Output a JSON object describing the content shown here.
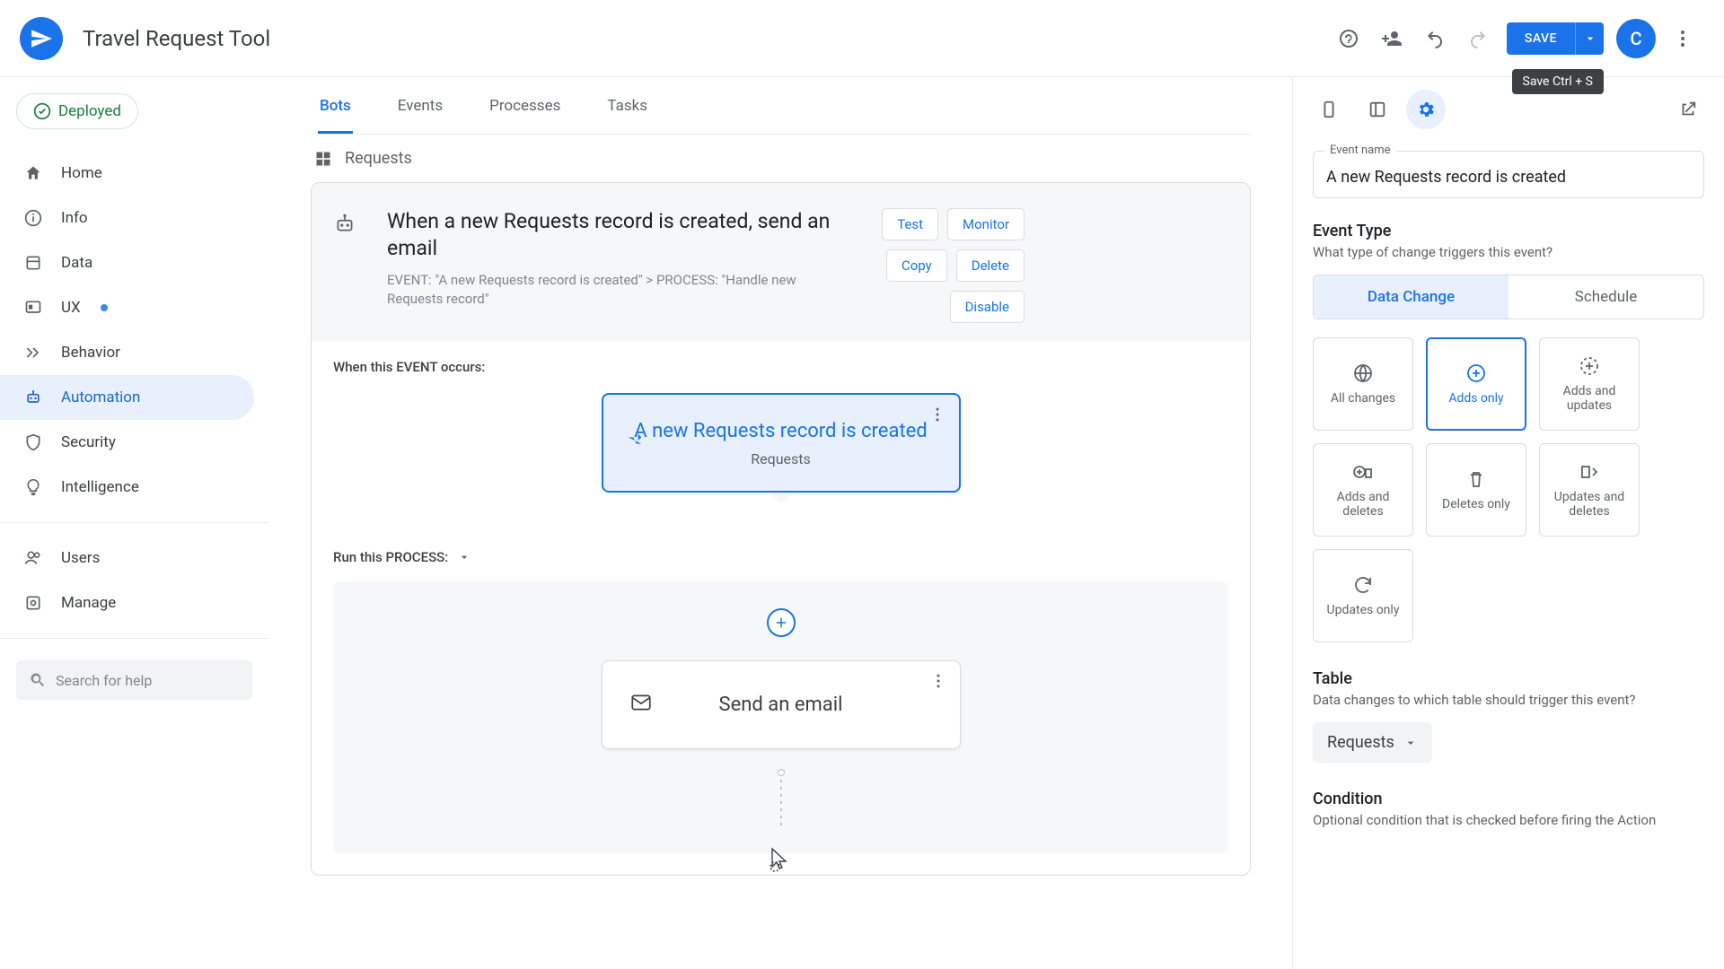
{
  "app": {
    "title": "Travel Request Tool"
  },
  "topbar": {
    "save_label": "SAVE",
    "save_tooltip": "Save Ctrl + S",
    "avatar_letter": "C"
  },
  "sidebar": {
    "deployed_label": "Deployed",
    "items": [
      {
        "label": "Home"
      },
      {
        "label": "Info"
      },
      {
        "label": "Data"
      },
      {
        "label": "UX",
        "dot": true
      },
      {
        "label": "Behavior"
      },
      {
        "label": "Automation",
        "active": true
      },
      {
        "label": "Security"
      },
      {
        "label": "Intelligence"
      }
    ],
    "lower_items": [
      {
        "label": "Users"
      },
      {
        "label": "Manage"
      }
    ],
    "search_placeholder": "Search for help"
  },
  "center": {
    "tabs": [
      {
        "label": "Bots",
        "active": true
      },
      {
        "label": "Events"
      },
      {
        "label": "Processes"
      },
      {
        "label": "Tasks"
      }
    ],
    "breadcrumb": "Requests",
    "bot": {
      "title": "When a new Requests record is created, send an email",
      "subtitle": "EVENT: \"A new Requests record is created\" > PROCESS: \"Handle new Requests record\"",
      "actions": [
        "Test",
        "Monitor",
        "Copy",
        "Delete",
        "Disable"
      ],
      "event_section_label": "When this EVENT occurs:",
      "event_node": {
        "title": "A new Requests record is created",
        "subtitle": "Requests"
      },
      "process_section_label": "Run this PROCESS:",
      "step_node": {
        "title": "Send an email"
      }
    }
  },
  "rpanel": {
    "event_name_label": "Event name",
    "event_name_value": "A new Requests record is created",
    "event_type_title": "Event Type",
    "event_type_desc": "What type of change triggers this event?",
    "segmented": [
      {
        "label": "Data Change",
        "active": true
      },
      {
        "label": "Schedule"
      }
    ],
    "change_options": [
      {
        "label": "All changes"
      },
      {
        "label": "Adds only",
        "active": true
      },
      {
        "label": "Adds and updates"
      },
      {
        "label": "Adds and deletes"
      },
      {
        "label": "Deletes only"
      },
      {
        "label": "Updates and deletes"
      },
      {
        "label": "Updates only"
      }
    ],
    "table_title": "Table",
    "table_desc": "Data changes to which table should trigger this event?",
    "table_value": "Requests",
    "condition_title": "Condition",
    "condition_desc": "Optional condition that is checked before firing the Action"
  }
}
